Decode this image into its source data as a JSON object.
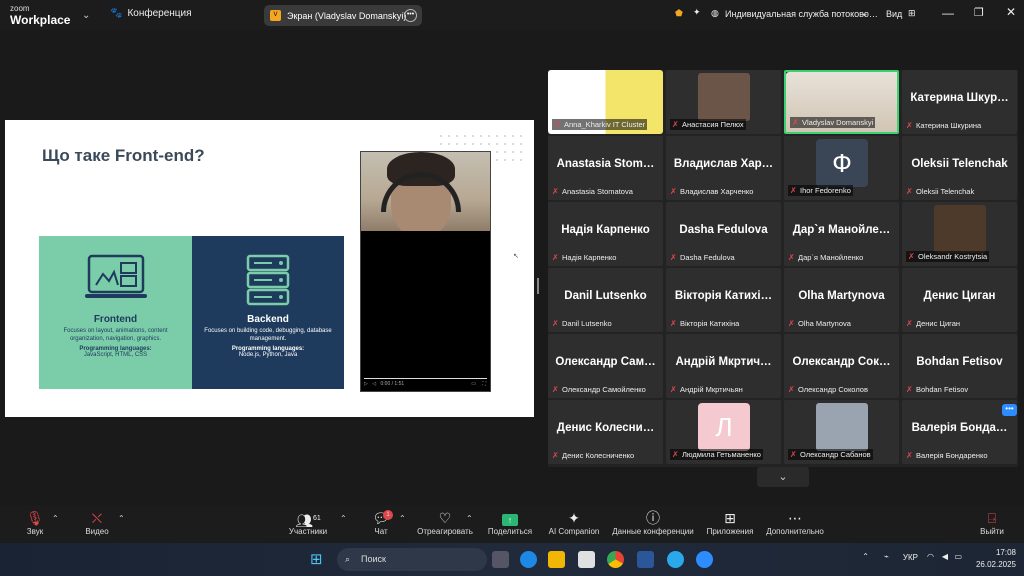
{
  "app": {
    "logo_top": "zoom",
    "logo_bottom": "Workplace",
    "conference_label": "Конференция"
  },
  "screen_share": {
    "label": "Экран (Vladyslav Domanskyi)"
  },
  "top_right": {
    "interpreting": "Индивидуальная служба потоково…",
    "view_label": "Вид"
  },
  "slide": {
    "title": "Що таке Front-end?",
    "frontend": {
      "title": "Frontend",
      "desc": "Focuses on layout, animations, content organization, navigation, graphics.",
      "lang_label": "Programming languages:",
      "langs": "JavaScript, HTML, CSS"
    },
    "backend": {
      "title": "Backend",
      "desc": "Focuses on building code, debugging, database management.",
      "lang_label": "Programming languages:",
      "langs": "Node.js, Python, Java"
    },
    "video_time": "0:00 / 1:51"
  },
  "participants": [
    {
      "name": "Anna_Kharkiv IT Cluster",
      "type": "photo",
      "color": "#4a90c8"
    },
    {
      "name": "Анастасия Пелюх",
      "type": "photo",
      "color": "#6b5548"
    },
    {
      "name": "Vladyslav Domanskyi",
      "type": "photo",
      "color": "#d9cfc0",
      "active": true
    },
    {
      "name": "Катерина Шкурина",
      "big": "Катерина Шкур…",
      "type": "text"
    },
    {
      "name": "Anastasia Stomatova",
      "big": "Anastasia Stom…",
      "type": "text"
    },
    {
      "name": "Владислав Харченко",
      "big": "Владислав Хар…",
      "type": "text"
    },
    {
      "name": "Ihor Fedorenko",
      "type": "avatar",
      "letter": "Ф",
      "color": "#3a4556"
    },
    {
      "name": "Oleksii Telenchak",
      "big": "Oleksii Telenchak",
      "type": "text"
    },
    {
      "name": "Надія Карпенко",
      "big": "Надія Карпенко",
      "type": "text"
    },
    {
      "name": "Dasha Fedulova",
      "big": "Dasha Fedulova",
      "type": "text"
    },
    {
      "name": "Дар`я Манойленко",
      "big": "Дар`я Манойле…",
      "type": "text"
    },
    {
      "name": "Oleksandr Kostrytsia",
      "type": "photo",
      "color": "#4d3a2b"
    },
    {
      "name": "Danil Lutsenko",
      "big": "Danil Lutsenko",
      "type": "text"
    },
    {
      "name": "Вікторія Катихіна",
      "big": "Вікторія Катихі…",
      "type": "text"
    },
    {
      "name": "Olha Martynova",
      "big": "Olha Martynova",
      "type": "text"
    },
    {
      "name": "Денис Циган",
      "big": "Денис Циган",
      "type": "text"
    },
    {
      "name": "Олександр Самойленко",
      "big": "Олександр Сам…",
      "type": "text"
    },
    {
      "name": "Андрій Мкртичьян",
      "big": "Андрій Мкртич…",
      "type": "text"
    },
    {
      "name": "Олександр Соколов",
      "big": "Олександр Сок…",
      "type": "text"
    },
    {
      "name": "Bohdan Fetisov",
      "big": "Bohdan Fetisov",
      "type": "text"
    },
    {
      "name": "Денис Колесниченко",
      "big": "Денис Колесни…",
      "type": "text"
    },
    {
      "name": "Людмила Гетьманенко",
      "type": "avatar",
      "letter": "Л",
      "color": "#f4c9cf"
    },
    {
      "name": "Олександр Сабанов",
      "type": "photo",
      "color": "#9aa4b0"
    },
    {
      "name": "Валерія Бондаренко",
      "big": "Валерія Бонда…",
      "type": "text"
    }
  ],
  "toolbar": {
    "audio": "Звук",
    "video": "Видео",
    "participants": "Участники",
    "participants_count": "61",
    "chat": "Чат",
    "chat_badge": "1",
    "react": "Отреагировать",
    "share": "Поделиться",
    "ai": "AI Companion",
    "meeting_info": "Данные конференции",
    "apps": "Приложения",
    "more": "Дополнительно",
    "leave": "Выйти"
  },
  "taskbar": {
    "search": "Поиск",
    "lang": "УКР",
    "time": "17:08",
    "date": "26.02.2025"
  }
}
